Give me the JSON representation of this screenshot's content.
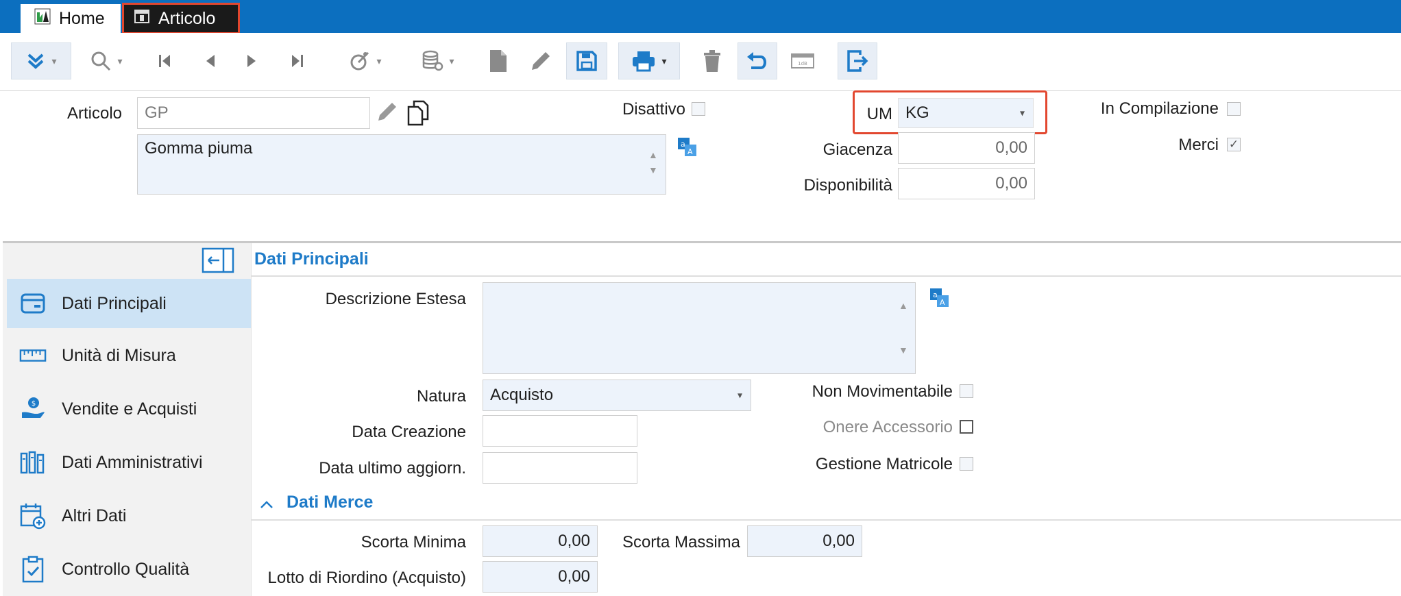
{
  "tabs": [
    {
      "label": "Home"
    },
    {
      "label": "Articolo"
    }
  ],
  "header": {
    "articolo_label": "Articolo",
    "articolo_code": "GP",
    "description": "Gomma piuma",
    "disattivo_label": "Disattivo",
    "um_label": "UM",
    "um_value": "KG",
    "giacenza_label": "Giacenza",
    "giacenza_value": "0,00",
    "disponibilita_label": "Disponibilità",
    "disponibilita_value": "0,00",
    "in_compilazione_label": "In Compilazione",
    "merci_label": "Merci",
    "merci_checked": true
  },
  "sidebar": {
    "items": [
      {
        "label": "Dati Principali",
        "icon": "card-icon",
        "active": true
      },
      {
        "label": "Unità di Misura",
        "icon": "ruler-icon"
      },
      {
        "label": "Vendite e Acquisti",
        "icon": "hand-coin-icon"
      },
      {
        "label": "Dati Amministrativi",
        "icon": "binders-icon"
      },
      {
        "label": "Altri Dati",
        "icon": "calendar-add-icon"
      },
      {
        "label": "Controllo Qualità",
        "icon": "clipboard-check-icon"
      }
    ]
  },
  "main": {
    "section_title": "Dati Principali",
    "descrizione_estesa_label": "Descrizione Estesa",
    "descrizione_estesa_value": "",
    "natura_label": "Natura",
    "natura_value": "Acquisto",
    "data_creazione_label": "Data Creazione",
    "data_creazione_value": "",
    "data_ultimo_label": "Data ultimo aggiorn.",
    "data_ultimo_value": "",
    "non_movimentabile_label": "Non Movimentabile",
    "onere_accessorio_label": "Onere Accessorio",
    "gestione_matricole_label": "Gestione Matricole",
    "dati_merce_title": "Dati Merce",
    "scorta_minima_label": "Scorta Minima",
    "scorta_minima_value": "0,00",
    "scorta_massima_label": "Scorta Massima",
    "scorta_massima_value": "0,00",
    "lotto_label": "Lotto di Riordino (Acquisto)",
    "lotto_value": "0,00"
  },
  "colors": {
    "titlebar": "#0c6fbf",
    "accent": "#1e7bc8",
    "highlight_border": "#e2472f",
    "active_nav": "#cde3f5"
  }
}
